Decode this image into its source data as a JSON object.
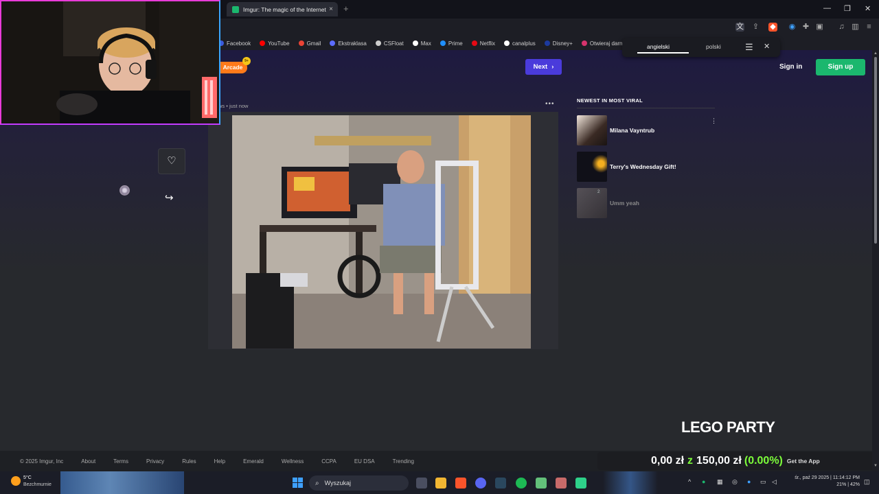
{
  "browser": {
    "tab_title": "Imgur: The magic of the Internet",
    "tab_close": "×",
    "new_tab": "+",
    "window_controls": [
      "—",
      "❐",
      "✕"
    ]
  },
  "bookmarks": [
    {
      "label": "Facebook",
      "color": "#3b5bdb"
    },
    {
      "label": "YouTube",
      "color": "#ff0000"
    },
    {
      "label": "Gmail",
      "color": "#ea4335"
    },
    {
      "label": "Ekstraklasa",
      "color": "#5b6cff"
    },
    {
      "label": "CSFloat",
      "color": "#cccccc"
    },
    {
      "label": "Max",
      "color": "#ffffff"
    },
    {
      "label": "Prime",
      "color": "#1f8fff"
    },
    {
      "label": "Netflix",
      "color": "#e50914"
    },
    {
      "label": "canalplus",
      "color": "#ffffff"
    },
    {
      "label": "Disney+",
      "color": "#1c3a9e"
    },
    {
      "label": "Otwieraj darm",
      "color": "#d6336c"
    }
  ],
  "translate_popup": {
    "source_lang": "angielski",
    "target_lang": "polski",
    "menu_icon": "☰",
    "close_icon": "✕"
  },
  "header": {
    "arcade_label": "Arcade",
    "arcade_badge": "9+",
    "next_label": "Next",
    "signin_label": "Sign in",
    "signup_label": "Sign up"
  },
  "post": {
    "meta": "ws • just now",
    "more": "•••"
  },
  "actions": {
    "like_icon": "♡",
    "share_icon": "↪"
  },
  "sidebar": {
    "title": "NEWEST IN MOST VIRAL",
    "items": [
      {
        "title": "Milana Vayntrub",
        "more": "⋮",
        "dim": false
      },
      {
        "title": "Terry's Wednesday Gift!",
        "more": "",
        "dim": false
      },
      {
        "title": "Umm yeah",
        "more": "",
        "dim": true,
        "count": "2"
      }
    ]
  },
  "overlay": {
    "lego": "LEGO PARTY",
    "promo_amount": "0,00 zł",
    "promo_z": "z",
    "promo_goal": "150,00 zł",
    "promo_pct": "(0.00%)",
    "promo_app": "Get the App"
  },
  "footer": {
    "links": [
      "© 2025 Imgur, Inc",
      "About",
      "Terms",
      "Privacy",
      "Rules",
      "Help",
      "Emerald",
      "Wellness",
      "CCPA",
      "EU DSA",
      "Trending"
    ]
  },
  "taskbar": {
    "weather_temp": "5°C",
    "weather_desc": "Bezchmurnie",
    "search_placeholder": "Wyszukaj",
    "clock_line1": "śr., paź 29 2025 | 11:14:12 PM",
    "clock_line2": "21% | 42%",
    "accent": "#3ea0ff"
  },
  "colors": {
    "brand_green": "#1bb76e",
    "next_blue": "#4a3bdb",
    "arcade_orange": "#ff7a1a",
    "promo_green": "#7cfc3a"
  }
}
